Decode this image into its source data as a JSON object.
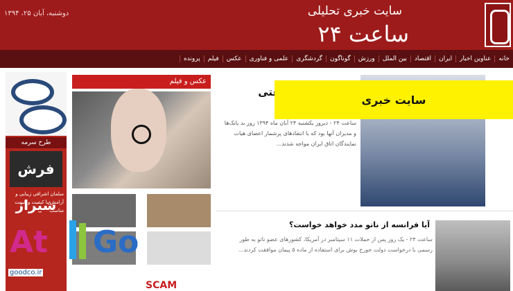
{
  "header": {
    "subtitle": "سایت خبری تحلیلی",
    "site_name": "ساعت ۲۴",
    "date": "دوشنبه، آبان ۲۵، ۱۳۹۴"
  },
  "nav": {
    "items": [
      "خانه",
      "عناوین اخبار",
      "ایران",
      "اقتصاد",
      "بین الملل",
      "ورزش",
      "گوناگون",
      "گردشگری",
      "علمی و فناوری",
      "عکس",
      "فیلم",
      "پرونده"
    ]
  },
  "ad": {
    "title": "طرح سرمه",
    "logo_text": "فرش شیراز",
    "body": "مبلمان اشرافی زیبایی و آرامش با کیفیت و قیمت مناسب",
    "domain": "goodco.ir"
  },
  "photo_section": {
    "title": "عکس و فیلم"
  },
  "main_article": {
    "headline": "کارتل ها ... کلفتی",
    "body": "ساعت ۲۴ - دیروز یکشنبه ۲۴ آبان ماه ۱۳۹۴ روز بد بانک‌ها و مدیران آنها بود که با انتقادهای پرشمار اعضای هیات نمایندگان اتاق ایران مواجه شدند..."
  },
  "second_article": {
    "headline": "آیا فرانسه از ناتو مدد خواهد خواست؟",
    "body": "ساعت ۲۴ - یک روز پس از حملات ۱۱ سپتامبر در آمریکا، کشورهای عضو ناتو به طور رسمی با درخواست دولت جورج بوش برای استفاده از ماده ۵ پیمان موافقت کردند..."
  },
  "overlay": {
    "label": "سایت خبری",
    "watermark_a": "At",
    "watermark_b": "Go",
    "bottom_text": "SCAM"
  }
}
